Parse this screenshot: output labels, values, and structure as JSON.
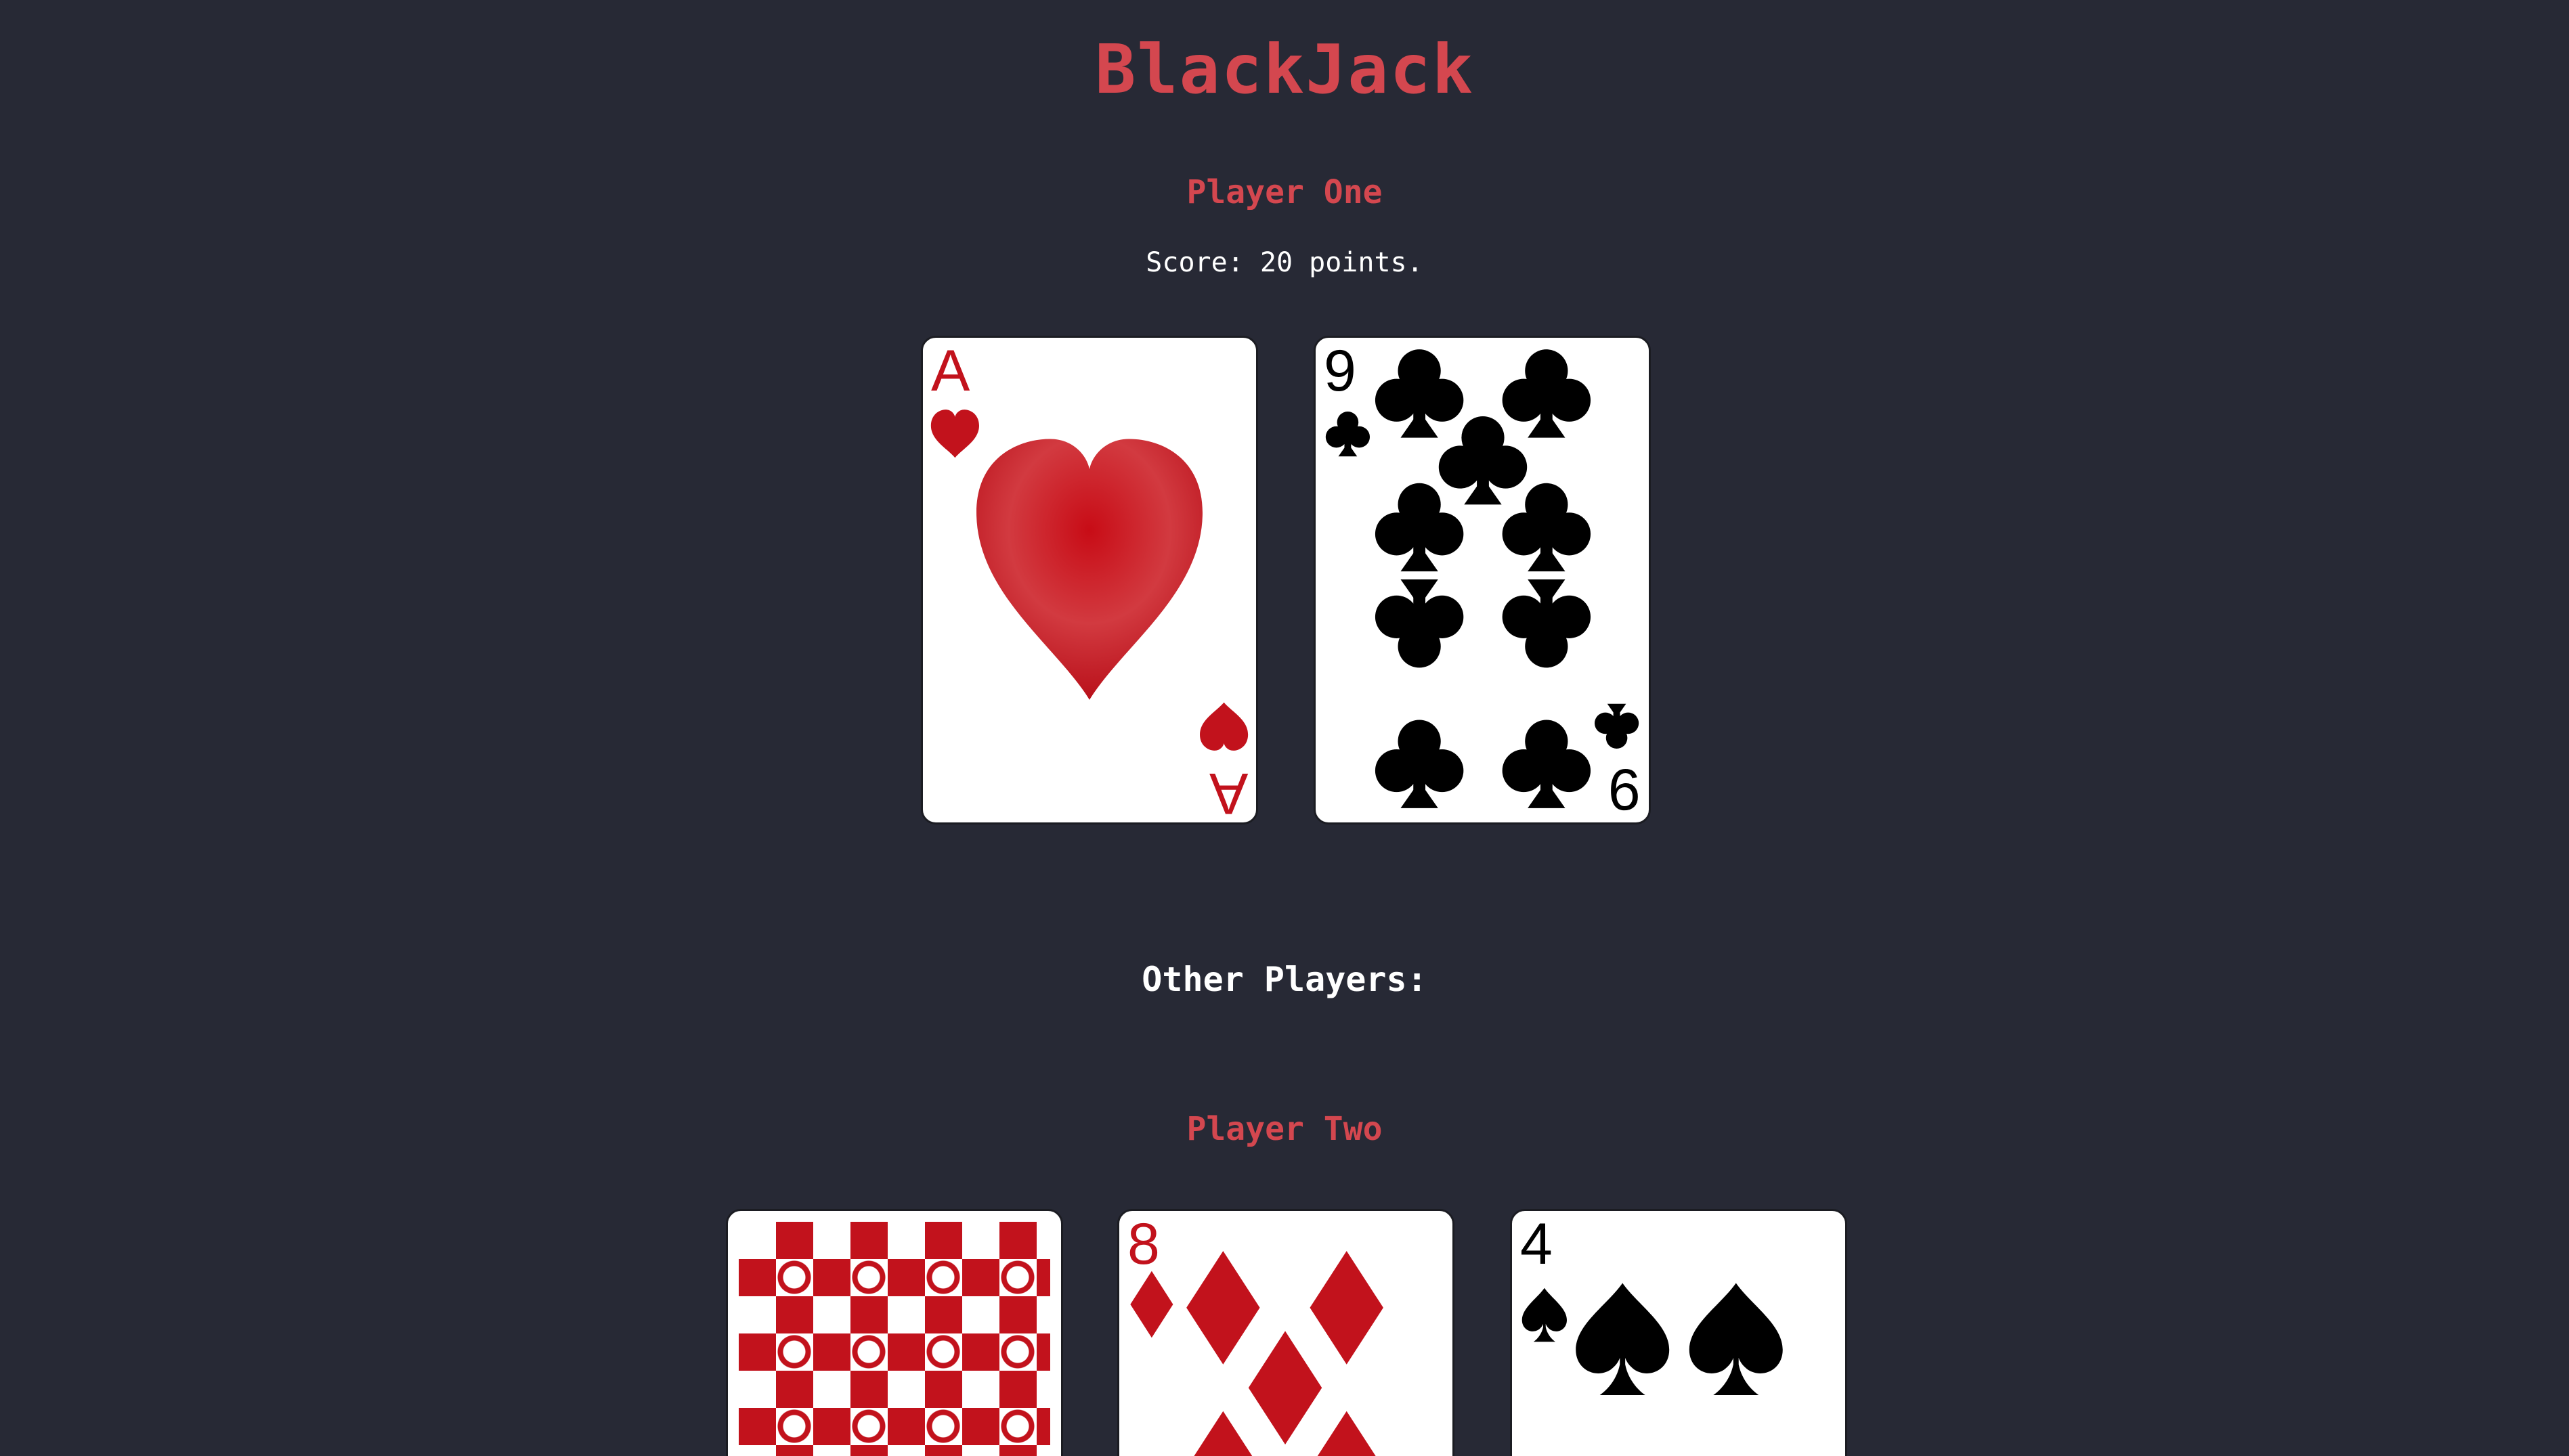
{
  "game": {
    "title": "BlackJack"
  },
  "player_one": {
    "name": "Player One",
    "score_text": "Score: 20 points.",
    "cards": [
      {
        "rank": "A",
        "suit": "hearts",
        "suit_symbol": "♥",
        "color": "#c2121c",
        "face_up": true
      },
      {
        "rank": "9",
        "suit": "clubs",
        "suit_symbol": "♣",
        "color": "#000000",
        "face_up": true
      }
    ]
  },
  "other_players": {
    "heading": "Other Players:",
    "players": [
      {
        "name": "Player Two",
        "cards": [
          {
            "rank": "",
            "suit": "",
            "suit_symbol": "",
            "color": "#c2121c",
            "face_up": false
          },
          {
            "rank": "8",
            "suit": "diamonds",
            "suit_symbol": "♦",
            "color": "#c2121c",
            "face_up": true
          },
          {
            "rank": "4",
            "suit": "spades",
            "suit_symbol": "♠",
            "color": "#000000",
            "face_up": true
          }
        ]
      }
    ]
  },
  "colors": {
    "background": "#272935",
    "accent": "#d4474f",
    "card_red": "#c2121c",
    "card_black": "#000000"
  }
}
